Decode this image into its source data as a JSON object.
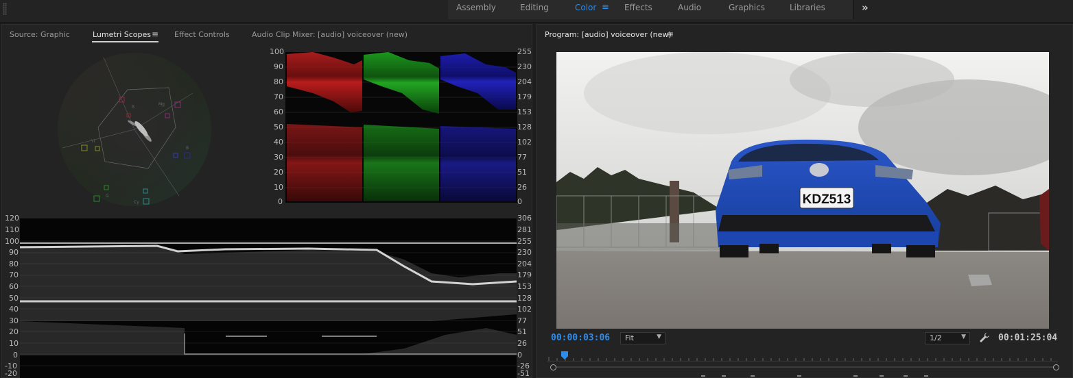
{
  "workspaces": {
    "tabs": [
      "Assembly",
      "Editing",
      "Color",
      "Effects",
      "Audio",
      "Graphics",
      "Libraries"
    ],
    "active": "Color",
    "menu_icon": "hamburger-icon",
    "overflow_icon": "double-chevron-right-icon",
    "overflow_glyph": "»",
    "menu_glyph": "≡"
  },
  "left_panel": {
    "tabs": [
      "Source: Graphic",
      "Lumetri Scopes",
      "Effect Controls",
      "Audio Clip Mixer: [audio] voiceover (new)"
    ],
    "active": "Lumetri Scopes",
    "vectorscope_labels": [
      "R",
      "Mg",
      "B",
      "Cy",
      "G",
      "Yl"
    ],
    "parade_left_axis": [
      "100",
      "90",
      "80",
      "70",
      "60",
      "50",
      "40",
      "30",
      "20",
      "10",
      "0"
    ],
    "parade_right_axis": [
      "255",
      "230",
      "204",
      "179",
      "153",
      "128",
      "102",
      "77",
      "51",
      "26",
      "0"
    ],
    "waveform_left_axis": [
      "120",
      "110",
      "100",
      "90",
      "80",
      "70",
      "60",
      "50",
      "40",
      "30",
      "20",
      "10",
      "0",
      "-10",
      "-20"
    ],
    "waveform_right_axis": [
      "306",
      "281",
      "255",
      "230",
      "204",
      "179",
      "153",
      "128",
      "102",
      "77",
      "51",
      "26",
      "0",
      "-26",
      "-51"
    ]
  },
  "program": {
    "title": "Program: [audio] voiceover (new)",
    "current_timecode": "00:00:03:06",
    "duration_timecode": "00:01:25:04",
    "zoom_value": "Fit",
    "resolution_value": "1/2",
    "plate_text": "KDZ513",
    "settings_icon": "wrench-icon",
    "accent": "#2d8ceb"
  }
}
